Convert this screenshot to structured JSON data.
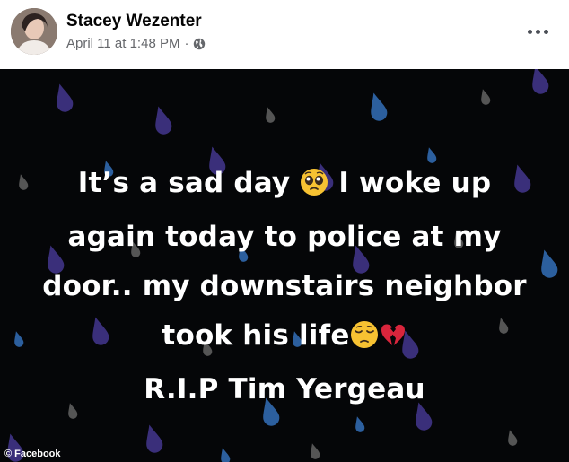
{
  "post": {
    "author": "Stacey Wezenter",
    "timestamp": "April 11 at 1:48 PM",
    "separator": "·",
    "audience_icon": "globe-icon",
    "more_icon": "more-horizontal-icon"
  },
  "status": {
    "line1a": "It’s a sad day",
    "line1b": "I woke up",
    "line2": "again today to police at my",
    "line3": "door.. my downstairs neighbor",
    "line4": "took his life",
    "line5": "R.I.P Tim Yergeau",
    "emojis": [
      "pleading-face-icon",
      "pensive-face-icon",
      "broken-heart-icon"
    ],
    "background": "#050608",
    "drop_colors": [
      "#3a2f7a",
      "#2c5f9e",
      "#555555"
    ]
  },
  "credit": "© Facebook"
}
